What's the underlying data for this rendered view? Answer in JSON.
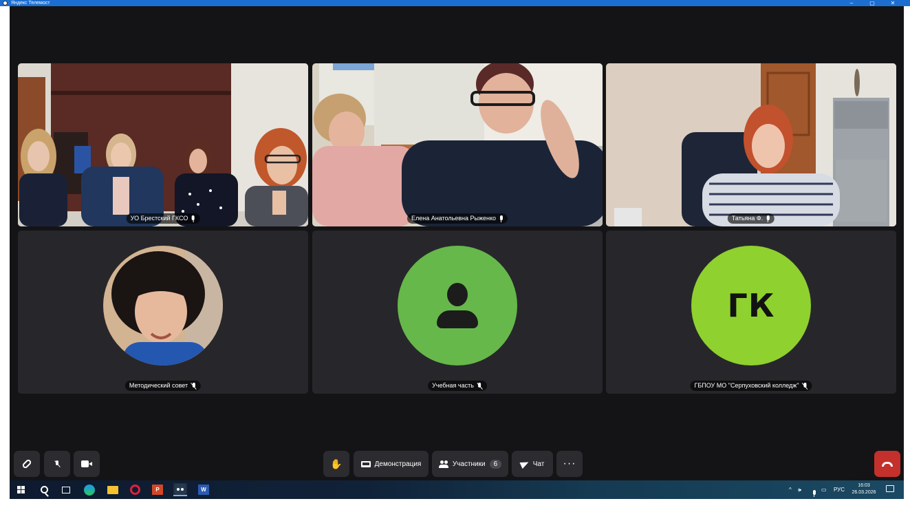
{
  "window": {
    "title": "Яндекс Телемост",
    "minimize": "–",
    "maximize": "▢",
    "close": "✕"
  },
  "tiles": [
    {
      "name": "УО Брестский ГКСО",
      "mic": "on",
      "video": true,
      "speaking": false
    },
    {
      "name": "Елена Анатольевна Рыженко",
      "mic": "on",
      "video": true,
      "speaking": false
    },
    {
      "name": "Татьяна Ф.",
      "mic": "on",
      "video": true,
      "speaking": true
    },
    {
      "name": "Методический совет",
      "mic": "off",
      "video": false,
      "avatar": "photo"
    },
    {
      "name": "Учебная часть",
      "mic": "off",
      "video": false,
      "avatar": "placeholder",
      "avatar_color": "#66b84a"
    },
    {
      "name": "ГБПОУ МО \"Серпуховский колледж\"",
      "mic": "off",
      "video": false,
      "avatar": "initials",
      "initials": "ГК",
      "avatar_color": "#8fd12e"
    }
  ],
  "controls": {
    "link_icon": "link-icon",
    "mic_icon": "mic-off-icon",
    "camera_icon": "camera-icon",
    "raise_hand_icon": "hand-icon",
    "demo_label": "Демонстрация",
    "participants_label": "Участники",
    "participants_count": "6",
    "chat_label": "Чат",
    "more_label": "···",
    "hangup_icon": "phone-hangup-icon"
  },
  "taskbar": {
    "ppt_label": "P",
    "word_label": "W",
    "tray_chevron": "^",
    "volume": "🕪",
    "language": "РУС",
    "time": "16:03",
    "date": "26.03.2026"
  },
  "colors": {
    "app_bg": "#141416",
    "tile_bg": "#27272b",
    "speaking_outline": "#46c35a",
    "hangup": "#c4302b",
    "titlebar": "#1c6fd1"
  }
}
